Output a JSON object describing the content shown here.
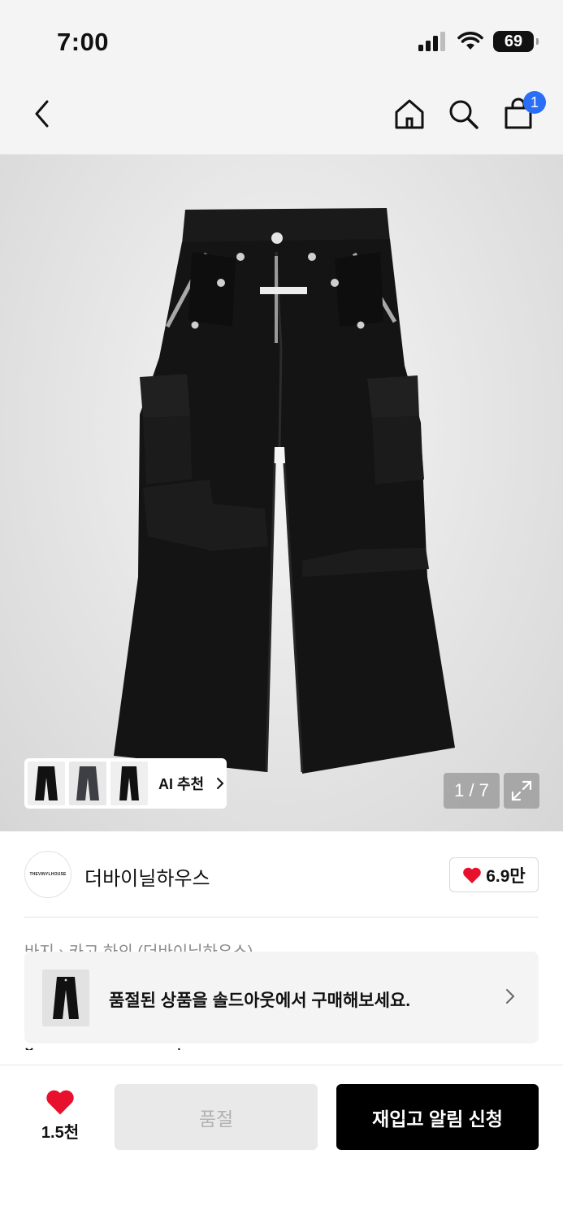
{
  "status": {
    "time": "7:00",
    "battery": "69"
  },
  "nav": {
    "cart_count": "1"
  },
  "hero": {
    "ai_label": "AI 추천",
    "counter": "1 / 7"
  },
  "brand": {
    "logo_text": "THEVINYLHOUSE",
    "name": "더바이닐하우스",
    "likes": "6.9만"
  },
  "soldout_banner": {
    "text": "품절된 상품을 솔드아웃에서 구매해보세요."
  },
  "peek": {
    "partial_text": "바지 › 카고 하의 (더바이닐하우스)"
  },
  "bottom": {
    "wish_count": "1.5천",
    "soldout_label": "품절",
    "restock_label": "재입고 알림 신청"
  },
  "colors": {
    "accent_badge": "#2a6ef5",
    "heart": "#e8112d",
    "primary_button": "#000000"
  }
}
